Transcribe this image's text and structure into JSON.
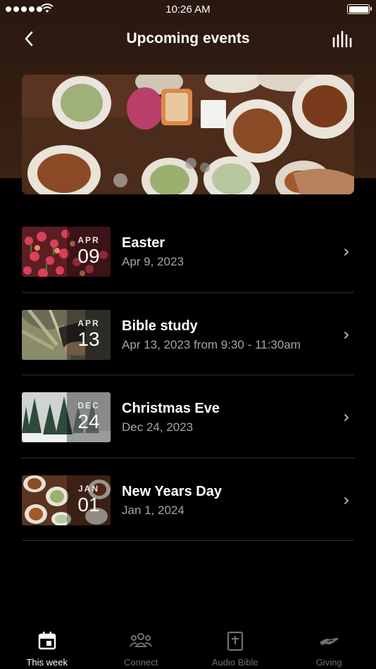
{
  "status_bar": {
    "time": "10:26 AM"
  },
  "header": {
    "title": "Upcoming events"
  },
  "events": [
    {
      "month": "APR",
      "day": "09",
      "title": "Easter",
      "subtitle": "Apr 9, 2023"
    },
    {
      "month": "APR",
      "day": "13",
      "title": "Bible study",
      "subtitle": "Apr 13, 2023 from 9:30 - 11:30am"
    },
    {
      "month": "DEC",
      "day": "24",
      "title": "Christmas Eve",
      "subtitle": "Dec 24, 2023"
    },
    {
      "month": "JAN",
      "day": "01",
      "title": "New Years Day",
      "subtitle": "Jan 1, 2024"
    }
  ],
  "tabbar": {
    "tabs": [
      {
        "label": "This week",
        "icon": "calendar-icon",
        "active": true
      },
      {
        "label": "Connect",
        "icon": "people-icon",
        "active": false
      },
      {
        "label": "Audio Bible",
        "icon": "bible-icon",
        "active": false
      },
      {
        "label": "Giving",
        "icon": "giving-hand-icon",
        "active": false
      }
    ]
  },
  "colors": {
    "header_bg": "#3a2214",
    "background": "#000000",
    "muted_text": "#a5a5a5",
    "inactive_tab": "#707070"
  }
}
